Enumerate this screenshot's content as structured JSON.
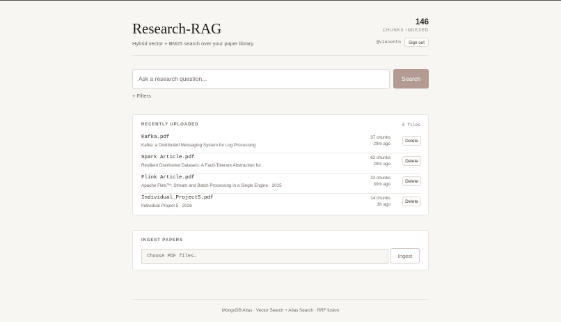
{
  "header": {
    "title": "Research-RAG",
    "subtitle": "Hybrid vector + BM25 search over your paper library.",
    "chunks_count": "146",
    "chunks_label": "CHUNKS INDEXED",
    "username": "@vincentn",
    "signout_label": "Sign out"
  },
  "search": {
    "placeholder": "Ask a research question...",
    "button_label": "Search",
    "filters_label": "+ Filters"
  },
  "recent": {
    "title": "RECENTLY UPLOADED",
    "count": "4 files",
    "delete_label": "Delete",
    "files": [
      {
        "name": "Kafka.pdf",
        "desc": "Kafka: a Distributed Messaging System for Log Processing",
        "chunks": "37 chunks",
        "age": "29m ago"
      },
      {
        "name": "Spark Article.pdf",
        "desc": "Resilient Distributed Datasets: A Fault-Tolerant Abstraction for",
        "chunks": "62 chunks",
        "age": "29m ago"
      },
      {
        "name": "Flink Article.pdf",
        "desc": "Apache Flink™: Stream and Batch Processing in a Single Engine · 2015",
        "chunks": "33 chunks",
        "age": "30m ago"
      },
      {
        "name": "Individual_Project5.pdf",
        "desc": "Individual Project 5 · 2026",
        "chunks": "14 chunks",
        "age": "3h ago"
      }
    ]
  },
  "ingest": {
    "title": "INGEST PAPERS",
    "file_placeholder": "Choose PDF files…",
    "button_label": "Ingest"
  },
  "footer": {
    "text": "MongoDB Atlas · Vector Search + Atlas Search · RRF fusion"
  },
  "colors": {
    "accent": "#b39a92",
    "background": "#f7f6f3",
    "card": "#ffffff"
  }
}
